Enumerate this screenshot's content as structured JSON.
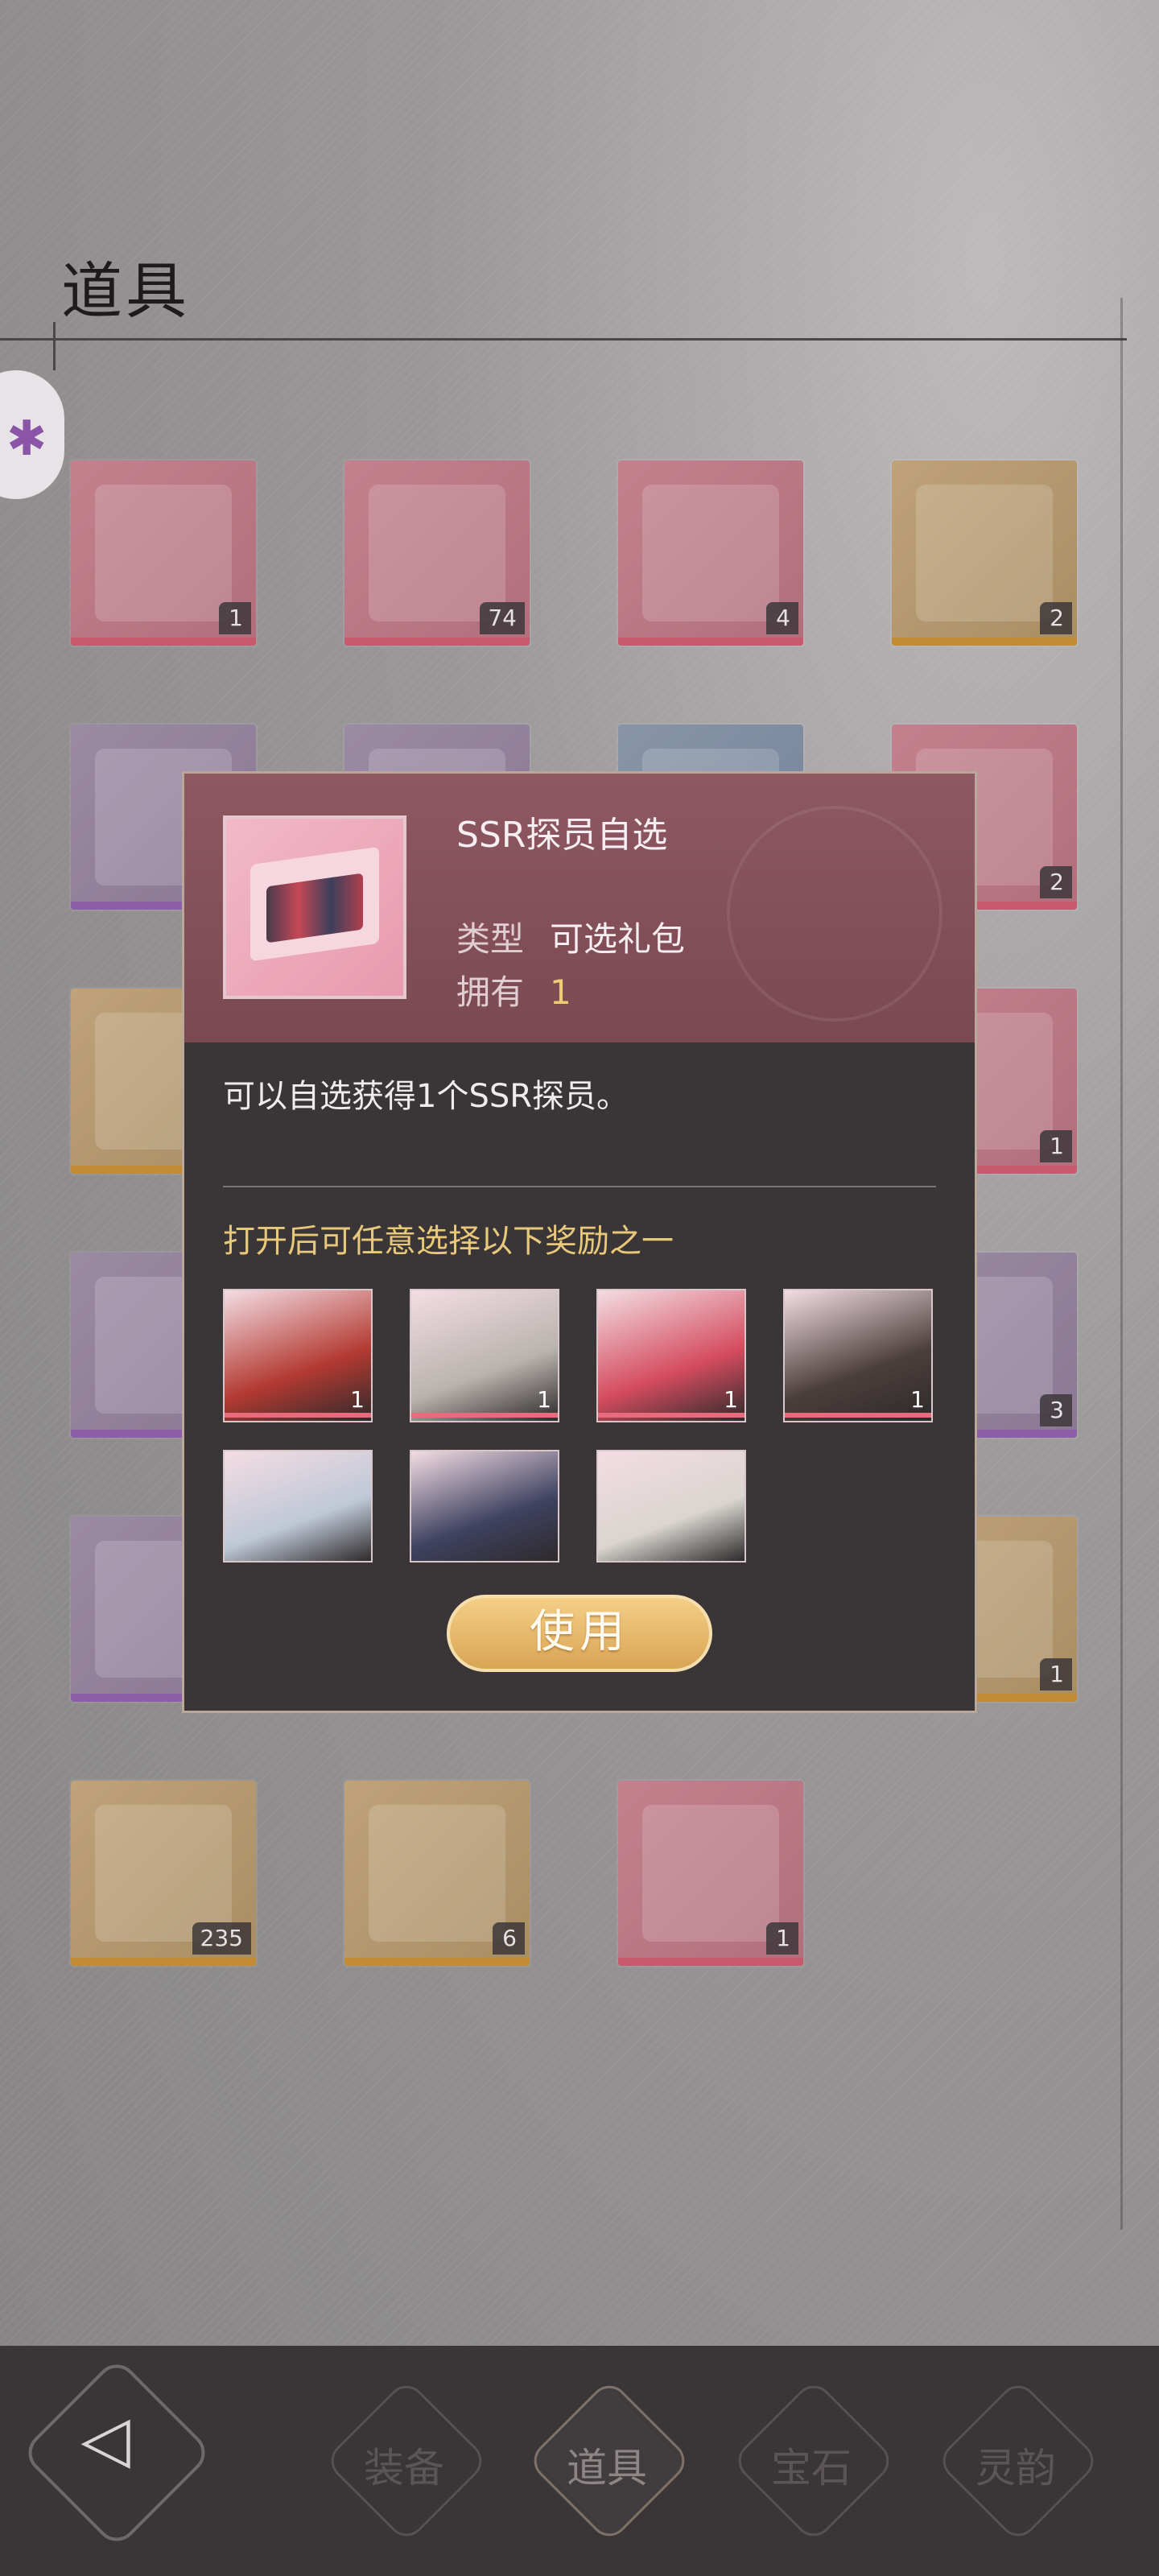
{
  "page": {
    "title": "道具"
  },
  "inventory": [
    {
      "count": "1",
      "color": "pink"
    },
    {
      "count": "74",
      "color": "pink"
    },
    {
      "count": "4",
      "color": "pink"
    },
    {
      "count": "2",
      "color": "gold"
    },
    {
      "count": "",
      "color": "purple"
    },
    {
      "count": "",
      "color": "purple"
    },
    {
      "count": "",
      "color": "blue"
    },
    {
      "count": "2",
      "color": "pink"
    },
    {
      "count": "",
      "color": "gold"
    },
    {
      "count": "",
      "color": "pink"
    },
    {
      "count": "",
      "color": "pink"
    },
    {
      "count": "1",
      "color": "pink"
    },
    {
      "count": "",
      "color": "purple"
    },
    {
      "count": "",
      "color": "purple"
    },
    {
      "count": "",
      "color": "purple"
    },
    {
      "count": "3",
      "color": "purple"
    },
    {
      "count": "",
      "color": "purple"
    },
    {
      "count": "",
      "color": "purple"
    },
    {
      "count": "",
      "color": "gold"
    },
    {
      "count": "1",
      "color": "gold"
    },
    {
      "count": "235",
      "color": "gold"
    },
    {
      "count": "6",
      "color": "gold"
    },
    {
      "count": "1",
      "color": "pink"
    }
  ],
  "modal": {
    "item_name": "SSR探员自选",
    "type_label": "类型",
    "type_value": "可选礼包",
    "own_label": "拥有",
    "own_value": "1",
    "description": "可以自选获得1个SSR探员。",
    "rewards_title": "打开后可任意选择以下奖励之一",
    "rewards": [
      {
        "count": "1",
        "tint": "#b33a32"
      },
      {
        "count": "1",
        "tint": "#b9b3ae"
      },
      {
        "count": "1",
        "tint": "#d44c5e"
      },
      {
        "count": "1",
        "tint": "#4b3f3c"
      },
      {
        "count": "",
        "tint": "#bfc8d6"
      },
      {
        "count": "",
        "tint": "#3f4261"
      },
      {
        "count": "",
        "tint": "#dad5d0"
      }
    ],
    "use_button": "使用"
  },
  "nav": {
    "tabs": [
      "装备",
      "道具",
      "宝石",
      "灵韵"
    ],
    "active": "道具"
  }
}
